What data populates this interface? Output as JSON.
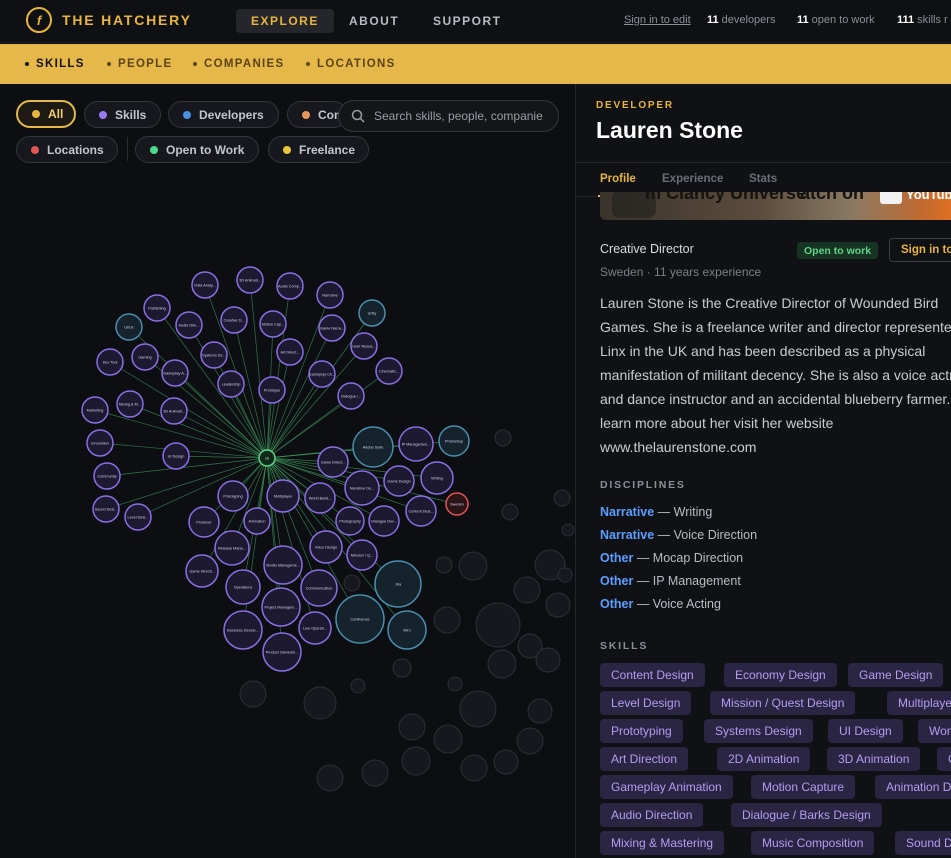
{
  "header": {
    "logo_glyph": "f",
    "brand": "THE HATCHERY",
    "nav": [
      {
        "label": "EXPLORE",
        "active": true
      },
      {
        "label": "ABOUT",
        "active": false
      },
      {
        "label": "SUPPORT",
        "active": false
      }
    ],
    "sign_in": "Sign in to edit",
    "stats": [
      {
        "value": "11",
        "label": "developers"
      },
      {
        "value": "11",
        "label": "open to work"
      },
      {
        "value": "111",
        "label": "skills r"
      }
    ]
  },
  "subnav": {
    "items": [
      {
        "label": "SKILLS",
        "active": true
      },
      {
        "label": "PEOPLE",
        "active": false
      },
      {
        "label": "COMPANIES",
        "active": false
      },
      {
        "label": "LOCATIONS",
        "active": false
      }
    ]
  },
  "filters": {
    "chips": [
      {
        "label": "All",
        "color": "#e8b53c",
        "active": true
      },
      {
        "label": "Skills",
        "color": "#9b7bf2",
        "active": false
      },
      {
        "label": "Developers",
        "color": "#4a90e2",
        "active": false
      },
      {
        "label": "Com",
        "color": "#e8955a",
        "active": false
      },
      {
        "label": "Locations",
        "color": "#e25555",
        "active": false
      },
      {
        "label": "Open to Work",
        "color": "#4cd98a",
        "active": false
      },
      {
        "label": "Freelance",
        "color": "#e8c53c",
        "active": false
      }
    ],
    "search_placeholder": "Search skills, people, companie"
  },
  "graph": {
    "hub_label": "cb",
    "edge_color": "#3d9a5c",
    "skill_color": "#8b6fe6",
    "dev_color": "#4a8fb0",
    "location_color": "#e25555",
    "nodes": [
      {
        "label": "Data Analy..."
      },
      {
        "label": "3D Animati..."
      },
      {
        "label": "Audio Comp..."
      },
      {
        "label": "Narrative"
      },
      {
        "label": "Publishing"
      },
      {
        "label": "Audio Dire..."
      },
      {
        "label": "Creative D..."
      },
      {
        "label": "Motion Cap..."
      },
      {
        "label": "Game Narra..."
      },
      {
        "label": "Unity"
      },
      {
        "label": "Gaming"
      },
      {
        "label": "Gameplay A..."
      },
      {
        "label": "Systems De..."
      },
      {
        "label": "Art Direct..."
      },
      {
        "label": "User Resea..."
      },
      {
        "label": "Dev Tool"
      },
      {
        "label": "Gameplay Ch..."
      },
      {
        "label": "Cinematic..."
      },
      {
        "label": "Ui/Ux"
      },
      {
        "label": "Mixing & M..."
      },
      {
        "label": "Leadership"
      },
      {
        "label": "Dialogue /..."
      },
      {
        "label": "Prototype"
      },
      {
        "label": "Marketing"
      },
      {
        "label": "3D Animati..."
      },
      {
        "label": "Adobe Suite"
      },
      {
        "label": "IP Managemen..."
      },
      {
        "label": "Photoshop"
      },
      {
        "label": "Innovation"
      },
      {
        "label": "UI Design"
      },
      {
        "label": "Game Direct..."
      },
      {
        "label": "Writing"
      },
      {
        "label": "Community"
      },
      {
        "label": "Narrative De..."
      },
      {
        "label": "Game Design"
      },
      {
        "label": "Prototyping"
      },
      {
        "label": "Multiplayer"
      },
      {
        "label": "World Build..."
      },
      {
        "label": "Content Desi..."
      },
      {
        "label": "Sweden"
      },
      {
        "label": "Sound Desi..."
      },
      {
        "label": "Level Desi..."
      },
      {
        "label": "Producer"
      },
      {
        "label": "Animation"
      },
      {
        "label": "Photography"
      },
      {
        "label": "Dialogue Dev..."
      },
      {
        "label": "Release Mana..."
      },
      {
        "label": "Voice Design"
      },
      {
        "label": "Mission / Q..."
      },
      {
        "label": "Game Directi..."
      },
      {
        "label": "Studio Manageme..."
      },
      {
        "label": "Jira"
      },
      {
        "label": "Operations"
      },
      {
        "label": "Communication"
      },
      {
        "label": "Project Managem..."
      },
      {
        "label": "Confluence"
      },
      {
        "label": "Live Operati..."
      },
      {
        "label": "Miro"
      },
      {
        "label": "Business Develo..."
      },
      {
        "label": "Product Ownersh..."
      }
    ]
  },
  "profile": {
    "kicker": "DEVELOPER",
    "name": "Lauren Stone",
    "tabs": [
      {
        "label": "Profile",
        "active": true
      },
      {
        "label": "Experience",
        "active": false
      },
      {
        "label": "Stats",
        "active": false
      }
    ],
    "video_caption": "m Clancy Universe",
    "video_caption_right": "atch on",
    "youtube_label": "YouTube",
    "role": "Creative Director",
    "open_to_work": "Open to work",
    "sign_in_button": "Sign in to",
    "meta": "Sweden · 11 years experience",
    "bio": "Lauren Stone is the Creative Director of Wounded Bird Games. She is a freelance writer and director represented by Linx in the UK and has been described as a physical manifestation of militant decency. She is also a voice actress and dance instructor and an accidental blueberry farmer. To learn more about her visit her website www.thelaurenstone.com",
    "disciplines_title": "DISCIPLINES",
    "disciplines": [
      {
        "category": "Narrative",
        "name": "Writing"
      },
      {
        "category": "Narrative",
        "name": "Voice Direction"
      },
      {
        "category": "Other",
        "name": "Mocap Direction"
      },
      {
        "category": "Other",
        "name": "IP Management"
      },
      {
        "category": "Other",
        "name": "Voice Acting"
      }
    ],
    "skills_title": "SKILLS",
    "skills": [
      [
        "Content Design",
        "Economy Design",
        "Game Design"
      ],
      [
        "Level Design",
        "Mission / Quest Design",
        "Multiplayer Design"
      ],
      [
        "Prototyping",
        "Systems Design",
        "UI Design",
        "World Building"
      ],
      [
        "Art Direction",
        "2D Animation",
        "3D Animation",
        "Cinematics"
      ],
      [
        "Gameplay Animation",
        "Motion Capture",
        "Animation Direction"
      ],
      [
        "Audio Direction",
        "Dialogue / Barks Design"
      ],
      [
        "Mixing & Mastering",
        "Music Composition",
        "Sound Design"
      ]
    ]
  }
}
